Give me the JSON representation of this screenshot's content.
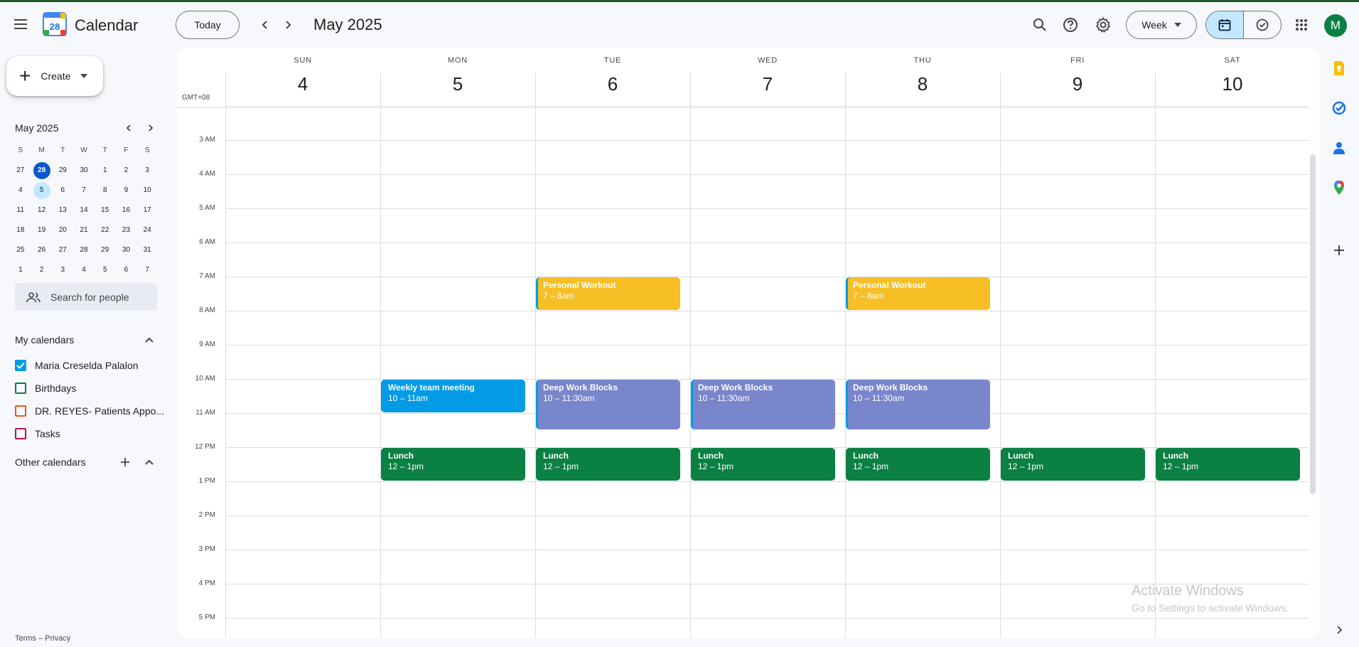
{
  "app": {
    "title": "Calendar",
    "logo_day": "28"
  },
  "header": {
    "today_label": "Today",
    "month_title": "May 2025",
    "view_label": "Week",
    "avatar_letter": "M"
  },
  "sidebar": {
    "create_label": "Create",
    "mini_calendar": {
      "title": "May 2025",
      "weekday_headers": [
        "S",
        "M",
        "T",
        "W",
        "T",
        "F",
        "S"
      ],
      "weeks": [
        [
          "27",
          "28",
          "29",
          "30",
          "1",
          "2",
          "3"
        ],
        [
          "4",
          "5",
          "6",
          "7",
          "8",
          "9",
          "10"
        ],
        [
          "11",
          "12",
          "13",
          "14",
          "15",
          "16",
          "17"
        ],
        [
          "18",
          "19",
          "20",
          "21",
          "22",
          "23",
          "24"
        ],
        [
          "25",
          "26",
          "27",
          "28",
          "29",
          "30",
          "31"
        ],
        [
          "1",
          "2",
          "3",
          "4",
          "5",
          "6",
          "7"
        ]
      ],
      "today_date": "28",
      "selected_date": "5"
    },
    "search_people_placeholder": "Search for people",
    "my_calendars_title": "My calendars",
    "my_calendars": [
      {
        "label": "Maria Creselda Palalon",
        "color": "#039be5",
        "checked": true
      },
      {
        "label": "Birthdays",
        "color": "#0b8043",
        "checked": false
      },
      {
        "label": "DR. REYES- Patients Appo...",
        "color": "#f4511e",
        "checked": false
      },
      {
        "label": "Tasks",
        "color": "#ad1457",
        "checked": false
      }
    ],
    "other_calendars_title": "Other calendars",
    "footer": "Terms – Privacy"
  },
  "week": {
    "timezone": "GMT+08",
    "days": [
      {
        "name": "SUN",
        "number": "4"
      },
      {
        "name": "MON",
        "number": "5"
      },
      {
        "name": "TUE",
        "number": "6"
      },
      {
        "name": "WED",
        "number": "7"
      },
      {
        "name": "THU",
        "number": "8"
      },
      {
        "name": "FRI",
        "number": "9"
      },
      {
        "name": "SAT",
        "number": "10"
      }
    ],
    "hours": [
      "3 AM",
      "4 AM",
      "5 AM",
      "6 AM",
      "7 AM",
      "8 AM",
      "9 AM",
      "10 AM",
      "11 AM",
      "12 PM",
      "1 PM",
      "2 PM",
      "3 PM",
      "4 PM",
      "5 PM"
    ],
    "events": [
      {
        "title": "Personal Workout",
        "time": "7 – 8am",
        "day": 2,
        "start": 7,
        "end": 8,
        "color": "#f6bf26"
      },
      {
        "title": "Personal Workout",
        "time": "7 – 8am",
        "day": 4,
        "start": 7,
        "end": 8,
        "color": "#f6bf26"
      },
      {
        "title": "Weekly team meeting",
        "time": "10 – 11am",
        "day": 1,
        "start": 10,
        "end": 11,
        "color": "#039be5"
      },
      {
        "title": "Deep Work Blocks",
        "time": "10 – 11:30am",
        "day": 2,
        "start": 10,
        "end": 11.5,
        "color": "#7986cb"
      },
      {
        "title": "Deep Work Blocks",
        "time": "10 – 11:30am",
        "day": 3,
        "start": 10,
        "end": 11.5,
        "color": "#7986cb"
      },
      {
        "title": "Deep Work Blocks",
        "time": "10 – 11:30am",
        "day": 4,
        "start": 10,
        "end": 11.5,
        "color": "#7986cb"
      },
      {
        "title": "Lunch",
        "time": "12 – 1pm",
        "day": 1,
        "start": 12,
        "end": 13,
        "color": "#0b8043"
      },
      {
        "title": "Lunch",
        "time": "12 – 1pm",
        "day": 2,
        "start": 12,
        "end": 13,
        "color": "#0b8043"
      },
      {
        "title": "Lunch",
        "time": "12 – 1pm",
        "day": 3,
        "start": 12,
        "end": 13,
        "color": "#0b8043"
      },
      {
        "title": "Lunch",
        "time": "12 – 1pm",
        "day": 4,
        "start": 12,
        "end": 13,
        "color": "#0b8043"
      },
      {
        "title": "Lunch",
        "time": "12 – 1pm",
        "day": 5,
        "start": 12,
        "end": 13,
        "color": "#0b8043"
      },
      {
        "title": "Lunch",
        "time": "12 – 1pm",
        "day": 6,
        "start": 12,
        "end": 13,
        "color": "#0b8043"
      }
    ]
  },
  "watermark": {
    "line1": "Activate Windows",
    "line2": "Go to Settings to activate Windows."
  },
  "colors": {
    "accent": "#0b57d0",
    "today_bg": "#0b57d0",
    "selected_bg": "#c2e7ff",
    "avatar": "#0b8043"
  }
}
